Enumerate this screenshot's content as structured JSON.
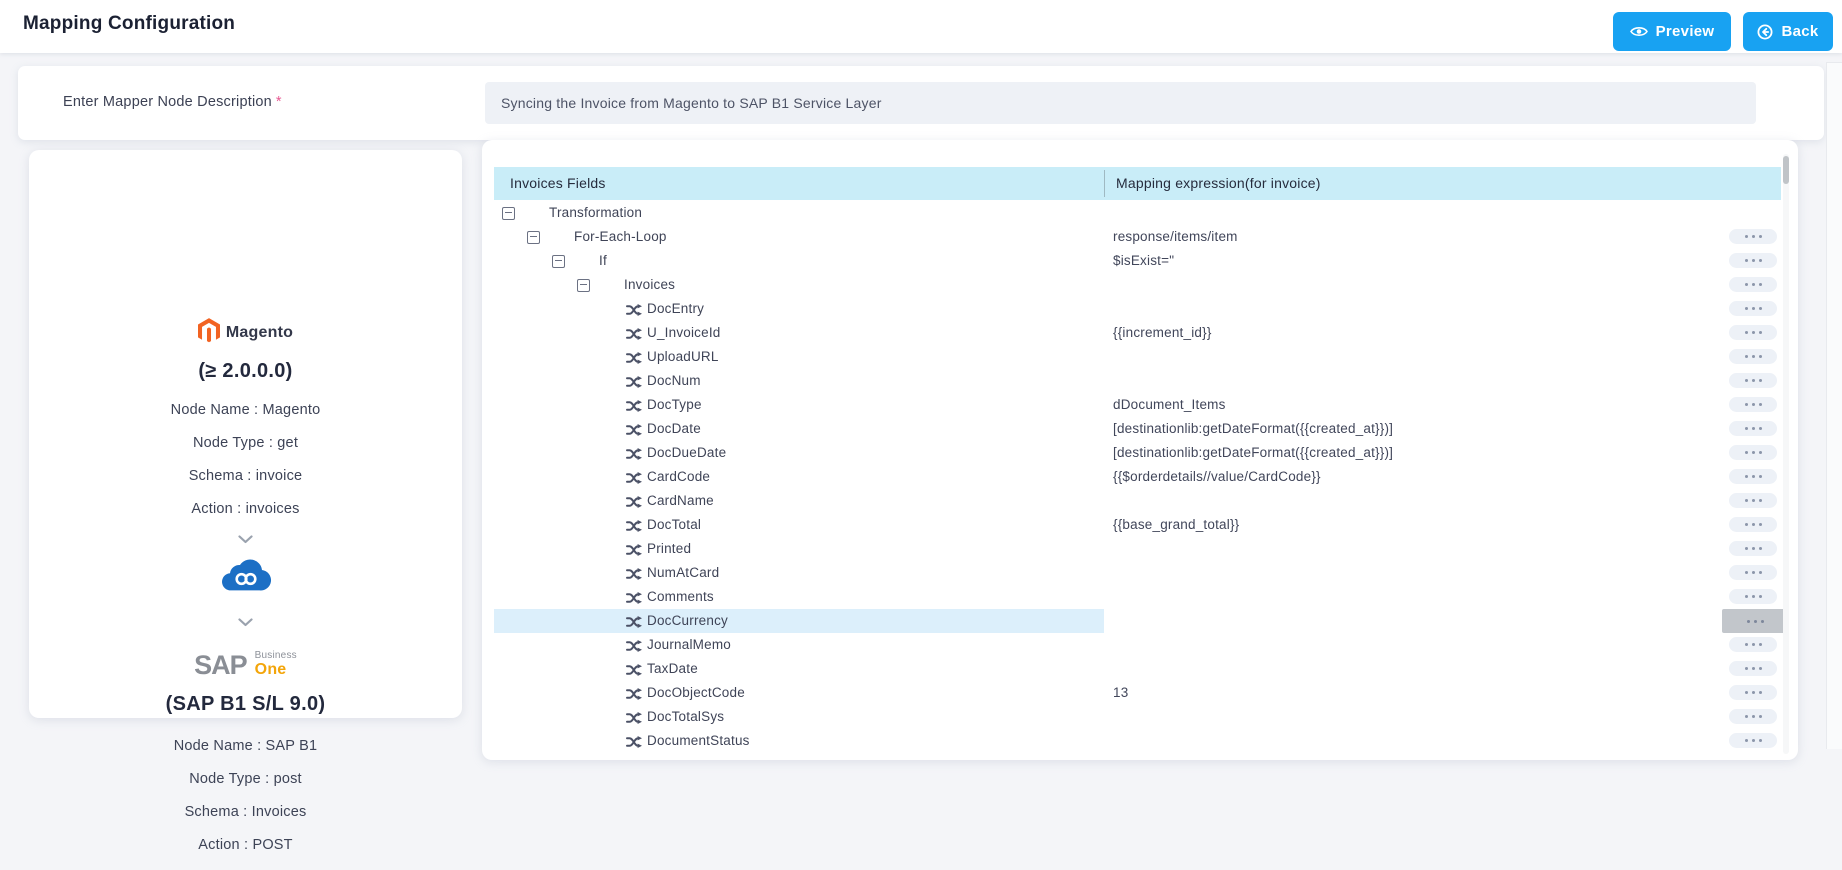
{
  "header": {
    "title": "Mapping Configuration",
    "preview_label": "Preview",
    "back_label": "Back"
  },
  "description": {
    "label": "Enter Mapper Node Description",
    "required_mark": "*",
    "value": "Syncing the Invoice from Magento to SAP B1 Service Layer"
  },
  "source_node": {
    "wordmark": "Magento",
    "version": "(≥ 2.0.0.0)",
    "info": [
      "Node Name : Magento",
      "Node Type : get",
      "Schema : invoice",
      "Action : invoices"
    ]
  },
  "target_node": {
    "sap": "SAP",
    "business": "Business",
    "one": "One",
    "version": "(SAP B1 S/L 9.0)",
    "info": [
      "Node Name : SAP B1",
      "Node Type : post",
      "Schema : Invoices",
      "Action : POST"
    ]
  },
  "mapping_table": {
    "columns": [
      "Invoices Fields",
      "Mapping expression(for invoice)"
    ],
    "rows": [
      {
        "label": "Transformation",
        "level": 0,
        "type": "branch",
        "expression": "",
        "selected": false,
        "has_action": false
      },
      {
        "label": "For-Each-Loop",
        "level": 1,
        "type": "branch",
        "expression": "response/items/item",
        "selected": false,
        "has_action": true
      },
      {
        "label": "If",
        "level": 2,
        "type": "branch",
        "expression": "$isExist=\"",
        "selected": false,
        "has_action": true
      },
      {
        "label": "Invoices",
        "level": 3,
        "type": "branch",
        "expression": "",
        "selected": false,
        "has_action": true
      },
      {
        "label": "DocEntry",
        "type": "leaf",
        "expression": "",
        "selected": false,
        "has_action": true
      },
      {
        "label": "U_InvoiceId",
        "type": "leaf",
        "expression": "{{increment_id}}",
        "selected": false,
        "has_action": true
      },
      {
        "label": "UploadURL",
        "type": "leaf",
        "expression": "",
        "selected": false,
        "has_action": true
      },
      {
        "label": "DocNum",
        "type": "leaf",
        "expression": "",
        "selected": false,
        "has_action": true
      },
      {
        "label": "DocType",
        "type": "leaf",
        "expression": "dDocument_Items",
        "selected": false,
        "has_action": true
      },
      {
        "label": "DocDate",
        "type": "leaf",
        "expression": "[destinationlib:getDateFormat({{created_at}})]",
        "selected": false,
        "has_action": true
      },
      {
        "label": "DocDueDate",
        "type": "leaf",
        "expression": "[destinationlib:getDateFormat({{created_at}})]",
        "selected": false,
        "has_action": true
      },
      {
        "label": "CardCode",
        "type": "leaf",
        "expression": "{{$orderdetails//value/CardCode}}",
        "selected": false,
        "has_action": true
      },
      {
        "label": "CardName",
        "type": "leaf",
        "expression": "",
        "selected": false,
        "has_action": true
      },
      {
        "label": "DocTotal",
        "type": "leaf",
        "expression": "{{base_grand_total}}",
        "selected": false,
        "has_action": true
      },
      {
        "label": "Printed",
        "type": "leaf",
        "expression": "",
        "selected": false,
        "has_action": true
      },
      {
        "label": "NumAtCard",
        "type": "leaf",
        "expression": "",
        "selected": false,
        "has_action": true
      },
      {
        "label": "Comments",
        "type": "leaf",
        "expression": "",
        "selected": false,
        "has_action": true
      },
      {
        "label": "DocCurrency",
        "type": "leaf",
        "expression": "",
        "selected": true,
        "has_action": true
      },
      {
        "label": "JournalMemo",
        "type": "leaf",
        "expression": "",
        "selected": false,
        "has_action": true
      },
      {
        "label": "TaxDate",
        "type": "leaf",
        "expression": "",
        "selected": false,
        "has_action": true
      },
      {
        "label": "DocObjectCode",
        "type": "leaf",
        "expression": "13",
        "selected": false,
        "has_action": true
      },
      {
        "label": "DocTotalSys",
        "type": "leaf",
        "expression": "",
        "selected": false,
        "has_action": true
      },
      {
        "label": "DocumentStatus",
        "type": "leaf",
        "expression": "",
        "selected": false,
        "has_action": true
      }
    ]
  },
  "colors": {
    "accent_blue": "#18a2f2",
    "table_header_cyan": "#c9edf8",
    "selected_row_blue": "#dceffb",
    "selected_action_gray": "#c2c6cb",
    "magento_orange": "#f26322",
    "sap_one_orange": "#f3a50a",
    "cloud_blue": "#1c6fc5",
    "required_pink": "#e75a92"
  }
}
